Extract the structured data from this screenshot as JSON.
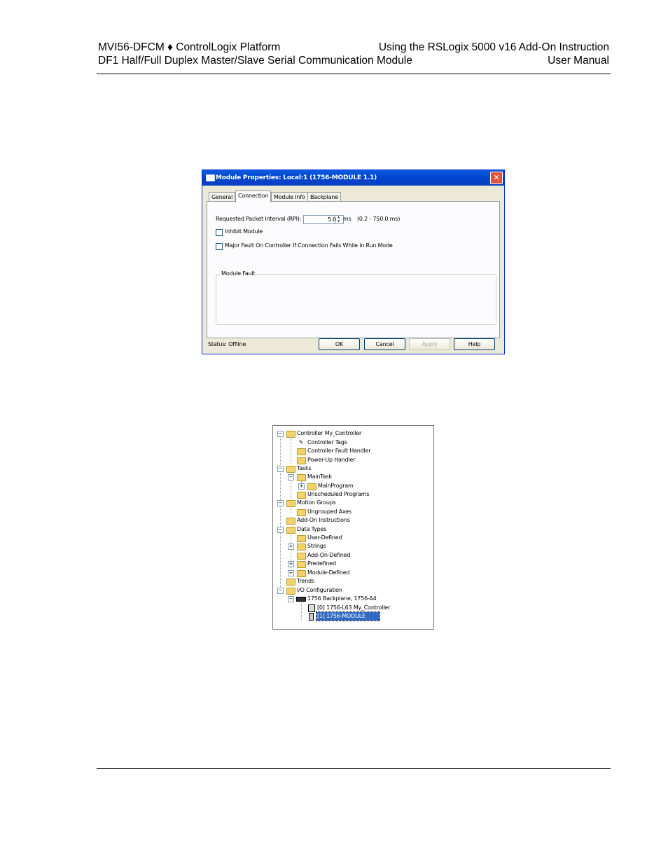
{
  "header": {
    "left_line1": "MVI56-DFCM ♦ ControlLogix Platform",
    "left_line2": "DF1 Half/Full Duplex Master/Slave Serial Communication Module",
    "right_line1": "Using the RSLogix 5000 v16 Add-On Instruction",
    "right_line2": "User Manual"
  },
  "dialog": {
    "title": "Module Properties: Local:1 (1756-MODULE 1.1)",
    "close": "✕",
    "tabs": [
      "General",
      "Connection",
      "Module Info",
      "Backplane"
    ],
    "rpi_label": "Requested Packet Interval (RPI):",
    "rpi_value": "5.0",
    "rpi_unit": "ms",
    "rpi_range": "(0.2 - 750.0 ms)",
    "inhibit_label": "Inhibit Module",
    "major_fault_label": "Major Fault On Controller If Connection Fails While in Run Mode",
    "module_fault_label": "Module Fault",
    "status": "Status:  Offline",
    "buttons": {
      "ok": "OK",
      "cancel": "Cancel",
      "apply": "Apply",
      "help": "Help"
    }
  },
  "tree": {
    "items": [
      {
        "label": "Controller My_Controller",
        "icon": "folder-icon"
      },
      {
        "label": "Controller Tags",
        "icon": "tags-icon"
      },
      {
        "label": "Controller Fault Handler",
        "icon": "folder-icon"
      },
      {
        "label": "Power-Up Handler",
        "icon": "folder-icon"
      },
      {
        "label": "Tasks",
        "icon": "folder-icon"
      },
      {
        "label": "MainTask",
        "icon": "task-icon"
      },
      {
        "label": "MainProgram",
        "icon": "program-icon"
      },
      {
        "label": "Unscheduled Programs",
        "icon": "folder-icon"
      },
      {
        "label": "Motion Groups",
        "icon": "folder-icon"
      },
      {
        "label": "Ungrouped Axes",
        "icon": "folder-icon"
      },
      {
        "label": "Add-On Instructions",
        "icon": "folder-icon"
      },
      {
        "label": "Data Types",
        "icon": "folder-icon"
      },
      {
        "label": "User-Defined",
        "icon": "datatype-icon"
      },
      {
        "label": "Strings",
        "icon": "datatype-icon"
      },
      {
        "label": "Add-On-Defined",
        "icon": "datatype-icon"
      },
      {
        "label": "Predefined",
        "icon": "datatype-icon"
      },
      {
        "label": "Module-Defined",
        "icon": "datatype-icon"
      },
      {
        "label": "Trends",
        "icon": "folder-icon"
      },
      {
        "label": "I/O Configuration",
        "icon": "folder-icon"
      },
      {
        "label": "1756 Backplane, 1756-A4",
        "icon": "backplane-icon"
      },
      {
        "label": "[0] 1756-L63 My_Controller",
        "icon": "controller-icon"
      },
      {
        "label": "[1] 1756-MODULE",
        "icon": "module-icon"
      }
    ]
  }
}
